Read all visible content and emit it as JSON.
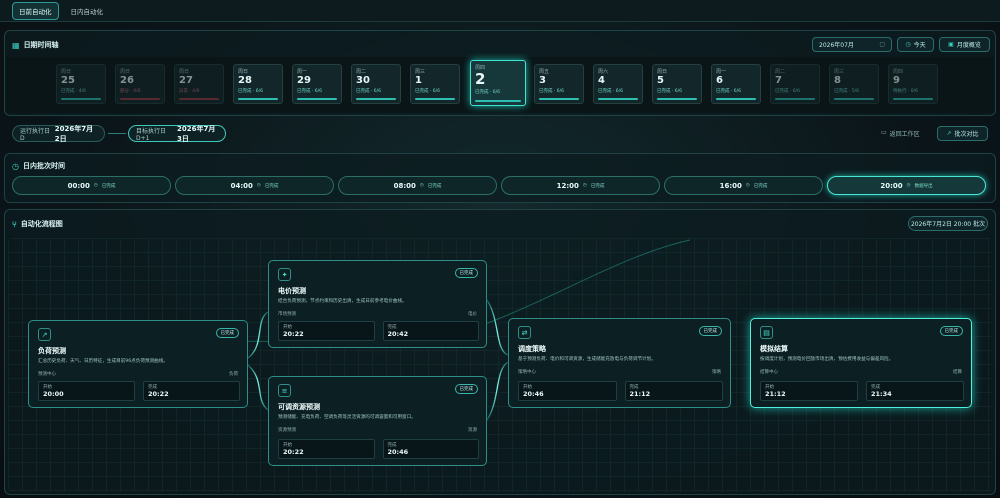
{
  "mode_tabs": [
    "日前自动化",
    "日内自动化"
  ],
  "day_panel": {
    "title": "日期时间轴",
    "month_value": "2026年07月",
    "today_label": "今天",
    "month_view_label": "月度概览"
  },
  "days": [
    {
      "wd": "周日",
      "dn": "25",
      "st": "已完成 · 4/6"
    },
    {
      "wd": "周日",
      "dn": "26",
      "st": "部分 · 4/6"
    },
    {
      "wd": "周日",
      "dn": "27",
      "st": "异常 · 4/6"
    },
    {
      "wd": "周日",
      "dn": "28",
      "st": "已完成 · 6/6"
    },
    {
      "wd": "周一",
      "dn": "29",
      "st": "已完成 · 6/6"
    },
    {
      "wd": "周二",
      "dn": "30",
      "st": "已完成 · 6/6"
    },
    {
      "wd": "周三",
      "dn": "1",
      "st": "已完成 · 6/6"
    },
    {
      "wd": "周四",
      "dn": "2",
      "st": "已完成 · 6/6"
    },
    {
      "wd": "周五",
      "dn": "3",
      "st": "已完成 · 6/6"
    },
    {
      "wd": "周六",
      "dn": "4",
      "st": "已完成 · 6/6"
    },
    {
      "wd": "周日",
      "dn": "5",
      "st": "已完成 · 6/6"
    },
    {
      "wd": "周一",
      "dn": "6",
      "st": "已完成 · 6/6"
    },
    {
      "wd": "周二",
      "dn": "7",
      "st": "已完成 · 6/6"
    },
    {
      "wd": "周三",
      "dn": "8",
      "st": "已完成 · 5/6"
    },
    {
      "wd": "周四",
      "dn": "9",
      "st": "待执行 · 0/6"
    }
  ],
  "row2": {
    "run_label": "运行执行日 D",
    "run_date": "2026年7月2日",
    "target_label": "目标执行日 D+1",
    "target_date": "2026年7月3日",
    "workspace_label": "返回工作区",
    "compare_label": "批次对比"
  },
  "intraday": {
    "title": "日内批次时间",
    "slots": [
      {
        "t": "00:00",
        "s": "已完成"
      },
      {
        "t": "04:00",
        "s": "已完成"
      },
      {
        "t": "08:00",
        "s": "已完成"
      },
      {
        "t": "12:00",
        "s": "已完成"
      },
      {
        "t": "16:00",
        "s": "已完成"
      },
      {
        "t": "20:00",
        "s": "数据导出"
      }
    ]
  },
  "flow": {
    "title": "自动化流程图",
    "stamp": "2026年7月2日 20:00 批次",
    "cards": [
      {
        "name": "负荷预测",
        "badge": "已完成",
        "desc": "汇总历史负荷、天气、日历特征，生成目前96点负荷预测曲线。",
        "left": "预测中心",
        "right": "负荷",
        "k1": "开始",
        "v1": "20:00",
        "k2": "完成",
        "v2": "20:22",
        "icon": "↗"
      },
      {
        "name": "电价预测",
        "badge": "已完成",
        "desc": "结合负荷预测，节点约束和历史出清，生成日前参考电价曲线。",
        "left": "市场预测",
        "right": "电价",
        "k1": "开始",
        "v1": "20:22",
        "k2": "完成",
        "v2": "20:42",
        "icon": "✦"
      },
      {
        "name": "可调资源预测",
        "badge": "已完成",
        "desc": "预测储能、充电负荷、空调负荷等灵活资源的可调容量和可用窗口。",
        "left": "资源预测",
        "right": "资源",
        "k1": "开始",
        "v1": "20:22",
        "k2": "完成",
        "v2": "20:46",
        "icon": "≡"
      },
      {
        "name": "调度策略",
        "badge": "已完成",
        "desc": "基于预测负荷、电价和可调资源，生成储能充放电与负荷调节计划。",
        "left": "策略中心",
        "right": "策略",
        "k1": "开始",
        "v1": "20:46",
        "k2": "完成",
        "v2": "21:12",
        "icon": "⇄"
      },
      {
        "name": "模拟结算",
        "badge": "已完成",
        "desc": "按调度计划，预测电价回放市场出清，预估费用收益与偏差风险。",
        "left": "结算中心",
        "right": "结算",
        "k1": "开始",
        "v1": "21:12",
        "k2": "完成",
        "v2": "21:34",
        "icon": "▤"
      }
    ]
  },
  "colors": {
    "accent": "#39d0c3",
    "warn": "#9b3a46"
  }
}
